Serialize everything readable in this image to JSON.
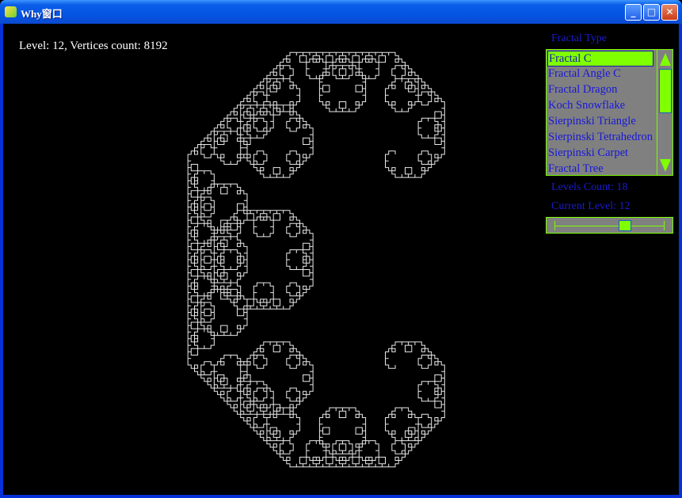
{
  "window": {
    "title": "Why窗口",
    "buttons": [
      "minimize",
      "maximize",
      "close"
    ]
  },
  "status": {
    "text": "Level: 12, Vertices count: 8192"
  },
  "panel": {
    "fractal_type_label": "Fractal Type",
    "fractal_types": [
      "Fractal C",
      "Fractal Angle C",
      "Fractal Dragon",
      "Koch Snowflake",
      "Sierpinski Triangle",
      "Sierpinski Tetrahedron",
      "Sierpinski Carpet",
      "Fractal Tree"
    ],
    "selected": "Fractal C",
    "levels_count_label": "Levels Count: 18",
    "current_level_label": "Current Level: 12",
    "levels_count": 18,
    "current_level": 12
  },
  "colors": {
    "accent": "#7fff00",
    "text": "#1818d8",
    "fractal": "#ffffff",
    "background": "#000000"
  }
}
